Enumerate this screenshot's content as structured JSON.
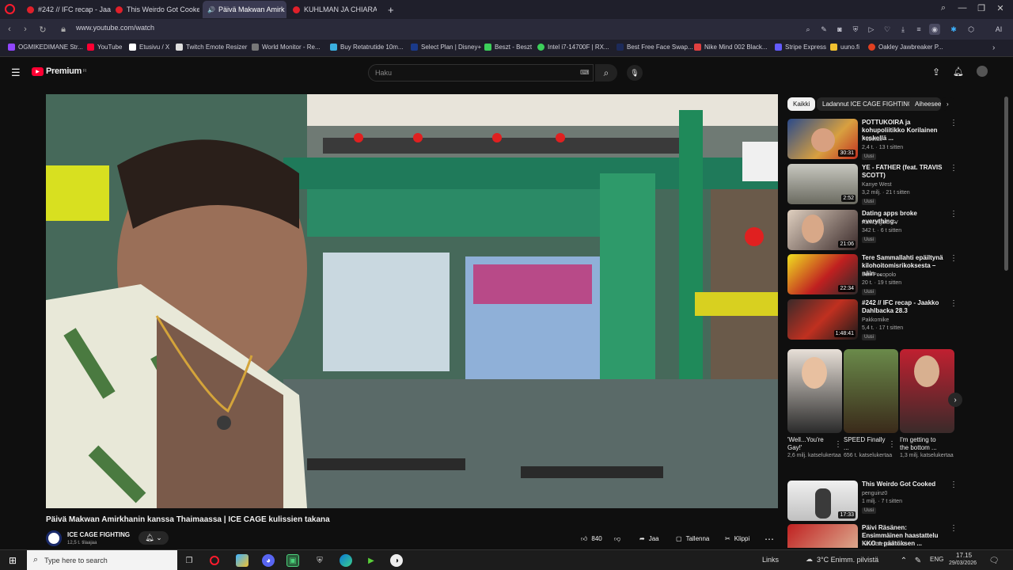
{
  "browser": {
    "tabs": [
      {
        "label": "#242 // IFC recap - Jaakko"
      },
      {
        "label": "This Weirdo Got Cooked"
      },
      {
        "label": "Päivä Makwan Amirk"
      },
      {
        "label": "KUHLMAN JA CHIARA Ka"
      }
    ],
    "new_tab": "+",
    "url": "www.youtube.com/watch",
    "bookmarks": [
      {
        "label": "OGMIKEDIMANE Str..."
      },
      {
        "label": "YouTube"
      },
      {
        "label": "Etusivu / X"
      },
      {
        "label": "Twitch Emote Resizer"
      },
      {
        "label": "World Monitor - Re..."
      },
      {
        "label": "Buy Retatrutide 10m..."
      },
      {
        "label": "Select Plan | Disney+"
      },
      {
        "label": "Beszt - Beszt"
      },
      {
        "label": "Intel i7-14700F | RX..."
      },
      {
        "label": "Best Free Face Swap..."
      },
      {
        "label": "Nike Mind 002 Black..."
      },
      {
        "label": "Stripe Express"
      },
      {
        "label": "uuno.fi"
      },
      {
        "label": "Oakley Jawbreaker P..."
      }
    ],
    "ai_label": "AI"
  },
  "youtube": {
    "logo": "Premium",
    "logo_sup": "FI",
    "search_placeholder": "Haku",
    "video_title": "Päivä Makwan Amirkhanin kanssa Thaimaassa | ICE CAGE kulissien takana",
    "channel_name": "ICE CAGE FIGHTING",
    "channel_subs": "12,5 t. tilaajaa",
    "likes": "840",
    "share": "Jaa",
    "save": "Tallenna",
    "clip": "Klippi",
    "chips": [
      "Kaikki",
      "Ladannut ICE CAGE FIGHTING",
      "Aiheeseen"
    ],
    "recommendations": [
      {
        "title": "POTTUKOIRA ja kohupoliitikko Korilainen keskellä ...",
        "channel": "Pubetus",
        "meta": "2,4 t. · 13 t sitten",
        "badge": "Uusi",
        "duration": "30:31"
      },
      {
        "title": "YE - FATHER (feat. TRAVIS SCOTT)",
        "channel": "Kanye West",
        "meta": "3,2 milj. · 21 t sitten",
        "badge": "Uusi",
        "duration": "2:52"
      },
      {
        "title": "Dating apps broke everything..",
        "channel": "Asmongold TV",
        "meta": "342 t. · 6 t sitten",
        "badge": "Uusi",
        "duration": "21:06"
      },
      {
        "title": "Tere Sammallahti epäiltynä kilohoitomisrikoksesta – näin ...",
        "channel": "Iren Pocopolo",
        "meta": "20 t. · 19 t sitten",
        "badge": "Uusi",
        "duration": "22:34"
      },
      {
        "title": "#242 // IFC recap - Jaakko Dahlbacka 28.3",
        "channel": "Pakkomike",
        "meta": "5,4 t. · 17 t sitten",
        "badge": "Uusi",
        "duration": "1:48:41"
      }
    ],
    "shorts": [
      {
        "title": "'Well...You're Gay!'",
        "views": "2,6 milj. katselukertaa"
      },
      {
        "title": "SPEED Finally ...",
        "views": "656 t. katselukertaa"
      },
      {
        "title": "I'm getting to the bottom ...",
        "views": "1,3 milj. katselukertaa"
      }
    ],
    "rec_bottom": [
      {
        "title": "This Weirdo Got Cooked",
        "channel": "penguinz0",
        "meta": "1 milj. · 7 t sitten",
        "badge": "Uusi",
        "duration": "17:33"
      },
      {
        "title": "Päivi Räsänen: Ensimmäinen haastattelu KKO:n päätöksen ...",
        "channel": "Kuuntele-podcast",
        "meta": "",
        "badge": "",
        "duration": ""
      }
    ]
  },
  "taskbar": {
    "search_placeholder": "Type here to search",
    "links": "Links",
    "weather": "3°C  Enimm. pilvistä",
    "lang": "ENG",
    "time": "17.15",
    "date": "29/03/2026"
  },
  "colors": {
    "youtube_red": "#ff0033",
    "tab_active": "#3a3a52",
    "background": "#0f0f0f"
  }
}
